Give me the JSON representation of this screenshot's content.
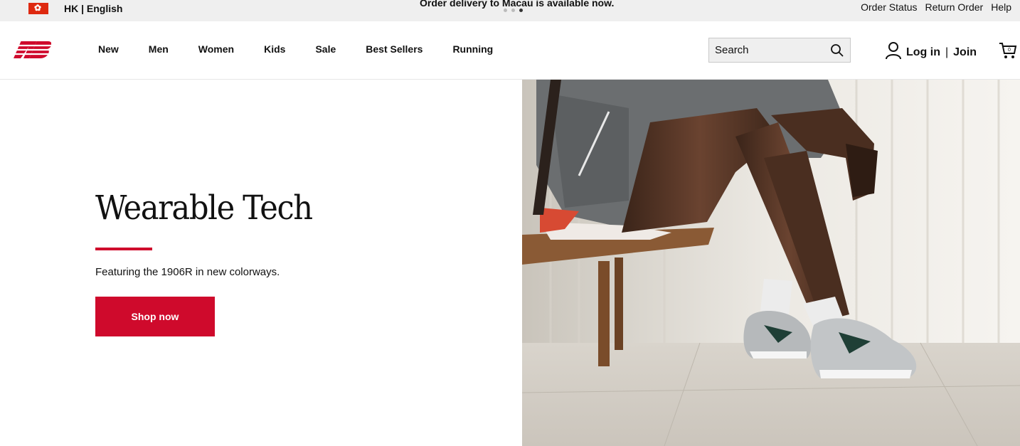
{
  "utility_bar": {
    "locale": "HK | English",
    "promo": "Order delivery to Macau is available now.",
    "links": [
      "Order Status",
      "Return Order",
      "Help"
    ]
  },
  "header": {
    "nav": [
      "New",
      "Men",
      "Women",
      "Kids",
      "Sale",
      "Best Sellers",
      "Running"
    ],
    "search_placeholder": "Search",
    "login": "Log in",
    "join": "Join"
  },
  "hero": {
    "title": "Wearable Tech",
    "subtitle": "Featuring the 1906R in new colorways.",
    "cta": "Shop now"
  },
  "colors": {
    "brand_red": "#cf0a2c",
    "utility_bg": "#efefef"
  }
}
